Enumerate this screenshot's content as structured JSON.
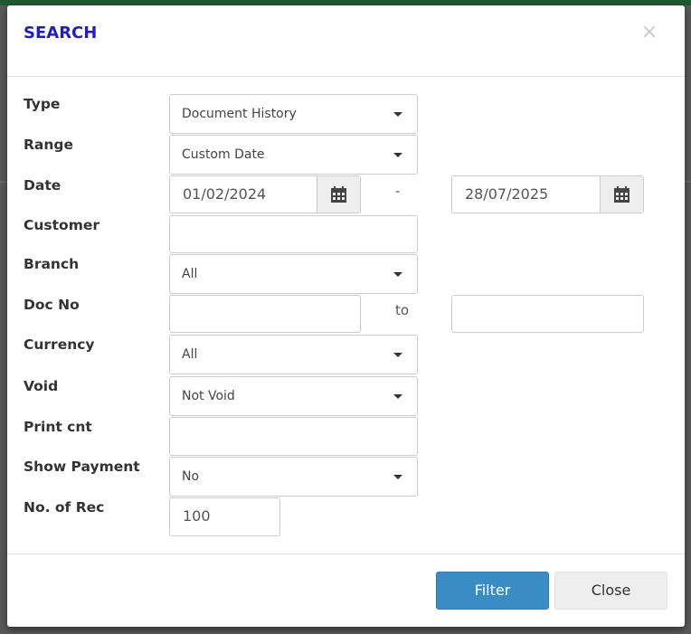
{
  "modal": {
    "title": "SEARCH",
    "close_symbol": "×"
  },
  "fields": {
    "type": {
      "label": "Type",
      "value": "Document History"
    },
    "range": {
      "label": "Range",
      "value": "Custom Date"
    },
    "date": {
      "label": "Date",
      "from": "01/02/2024",
      "separator": "-",
      "to": "28/07/2025"
    },
    "customer": {
      "label": "Customer",
      "value": ""
    },
    "branch": {
      "label": "Branch",
      "value": "All"
    },
    "doc_no": {
      "label": "Doc No",
      "from": "",
      "separator": "to",
      "to": ""
    },
    "currency": {
      "label": "Currency",
      "value": "All"
    },
    "void": {
      "label": "Void",
      "value": "Not Void"
    },
    "print_cnt": {
      "label": "Print cnt",
      "value": ""
    },
    "show_payment": {
      "label": "Show Payment",
      "value": "No"
    },
    "no_of_rec": {
      "label": "No. of Rec",
      "value": "100"
    }
  },
  "buttons": {
    "filter": "Filter",
    "close": "Close"
  },
  "icons": {
    "calendar": "calendar-icon",
    "caret": "caret-down-icon",
    "close": "close-icon"
  },
  "colors": {
    "title": "#1e1ec8",
    "filter_button": "#3a8dc4",
    "topbar": "#1f5a32"
  }
}
